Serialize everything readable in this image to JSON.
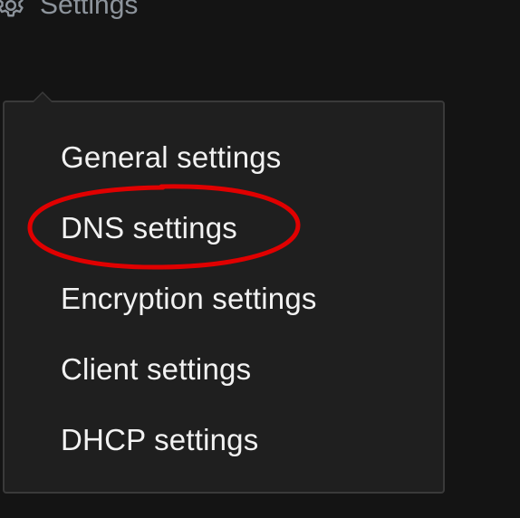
{
  "nav": {
    "settings_label": "Settings",
    "settings_icon": "gear-icon"
  },
  "dropdown": {
    "items": [
      {
        "label": "General settings"
      },
      {
        "label": "DNS settings",
        "highlighted": true
      },
      {
        "label": "Encryption settings"
      },
      {
        "label": "Client settings"
      },
      {
        "label": "DHCP settings"
      }
    ]
  },
  "colors": {
    "background": "#141414",
    "panel": "#1f1f1f",
    "panel_border": "#3a3a3a",
    "nav_text": "#8d949c",
    "item_text": "#f2f2f2",
    "highlight": "#e00000"
  }
}
